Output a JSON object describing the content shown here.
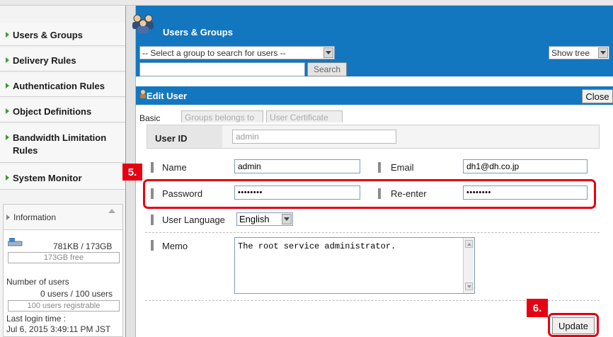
{
  "sidebar": {
    "items": [
      {
        "label": "Users & Groups"
      },
      {
        "label": "Delivery Rules"
      },
      {
        "label": "Authentication Rules"
      },
      {
        "label": "Object Definitions"
      },
      {
        "label": "Bandwidth Limitation Rules"
      },
      {
        "label": "System Monitor"
      }
    ],
    "information": {
      "title": "Information",
      "disk_usage": "781KB /  173GB",
      "disk_free": "173GB free",
      "users_label": "Number of users",
      "users_value": "0 users / 100 users",
      "users_remaining": "100 users registrable",
      "last_login_label": "Last login time :",
      "last_login_value": "Jul 6, 2015 3:49:11 PM JST"
    }
  },
  "header": {
    "title": "Users & Groups",
    "group_select": "-- Select a group to search for users --",
    "search_value": "",
    "search_button": "Search",
    "view_select": "Show tree"
  },
  "edit": {
    "title": "Edit User",
    "close": "Close",
    "tabs": [
      "Basic",
      "Groups belongs to",
      "User Certificate"
    ],
    "user_id_label": "User ID",
    "user_id_value": "admin",
    "name_label": "Name",
    "name_value": "admin",
    "email_label": "Email",
    "email_value": "dh1@dh.co.jp",
    "password_label": "Password",
    "password_value": "••••••••",
    "reenter_label": "Re-enter",
    "reenter_value": "••••••••",
    "language_label": "User Language",
    "language_value": "English",
    "memo_label": "Memo",
    "memo_value": "The root service administrator.",
    "update_button": "Update"
  },
  "callouts": {
    "step5": "5.",
    "step6": "6."
  },
  "colors": {
    "header_blue": "#1377c0",
    "callout_red": "#e60012",
    "nav_arrow_green": "#3a9a2e"
  }
}
